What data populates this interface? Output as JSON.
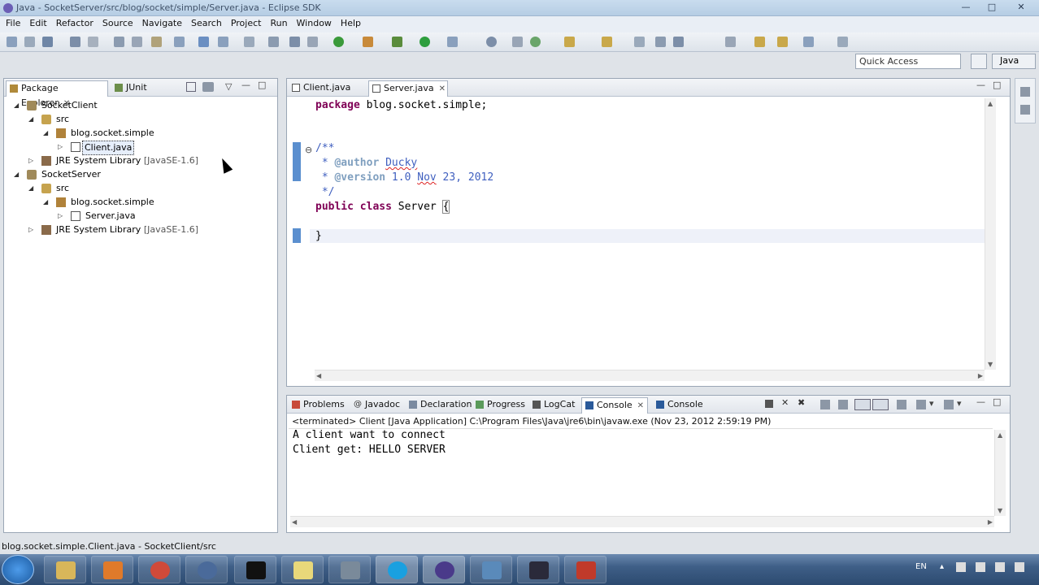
{
  "window": {
    "title": "Java - SocketServer/src/blog/socket/simple/Server.java - Eclipse SDK",
    "controls": [
      "—",
      "□",
      "✕"
    ]
  },
  "menu": [
    "File",
    "Edit",
    "Refactor",
    "Source",
    "Navigate",
    "Search",
    "Project",
    "Run",
    "Window",
    "Help"
  ],
  "quick_access": {
    "placeholder": "Quick Access"
  },
  "perspective": {
    "label": "Java"
  },
  "left_panel": {
    "tabs": [
      {
        "label": "Package Explorer",
        "close": "✕"
      },
      {
        "label": "JUnit"
      }
    ],
    "tree": [
      {
        "label": "SocketClient",
        "toggle": "◢"
      },
      {
        "label": "src",
        "toggle": "◢"
      },
      {
        "label": "blog.socket.simple",
        "toggle": "◢"
      },
      {
        "label": "Client.java",
        "toggle": "▷"
      },
      {
        "label": "JRE System Library",
        "extra": "[JavaSE-1.6]",
        "toggle": "▷"
      },
      {
        "label": "SocketServer",
        "toggle": "◢"
      },
      {
        "label": "src",
        "toggle": "◢"
      },
      {
        "label": "blog.socket.simple",
        "toggle": "◢"
      },
      {
        "label": "Server.java",
        "toggle": "▷"
      },
      {
        "label": "JRE System Library",
        "extra": "[JavaSE-1.6]",
        "toggle": "▷"
      }
    ]
  },
  "editor": {
    "tabs": [
      {
        "label": "Client.java"
      },
      {
        "label": "Server.java",
        "close": "✕"
      }
    ],
    "fold_marker": "⊖",
    "code": {
      "package_kw": "package",
      "package_name": " blog.socket.simple;",
      "doc_open": "/**",
      "author_prefix": " * ",
      "author_tag": "@author",
      "author_sp": " ",
      "author_name": "Ducky",
      "version_prefix": " * ",
      "version_tag": "@version",
      "version_num": " 1.0 ",
      "version_month": "Nov",
      "version_date": " 23, 2012",
      "doc_close": " */",
      "public_kw": "public",
      "class_kw": "class",
      "class_name": " Server ",
      "brace_open": "{",
      "brace_close": "}"
    }
  },
  "bottom_panel": {
    "tabs": [
      {
        "label": "Problems"
      },
      {
        "label": "Javadoc"
      },
      {
        "label": "Declaration"
      },
      {
        "label": "Progress"
      },
      {
        "label": "LogCat"
      },
      {
        "label": "Console",
        "close": "✕"
      },
      {
        "label": "Console"
      }
    ],
    "header": "<terminated> Client [Java Application] C:\\Program Files\\Java\\jre6\\bin\\javaw.exe (Nov 23, 2012 2:59:19 PM)",
    "output": [
      "A client want to connect",
      "Client get: HELLO SERVER"
    ]
  },
  "status": {
    "text": "blog.socket.simple.Client.java - SocketClient/src"
  },
  "taskbar": {
    "lang": "EN"
  },
  "colors": {
    "keyword": "#7f0055",
    "javadoc": "#3f5fbf",
    "doctag": "#7f9fbf",
    "gutter": "#5b8fcf"
  }
}
